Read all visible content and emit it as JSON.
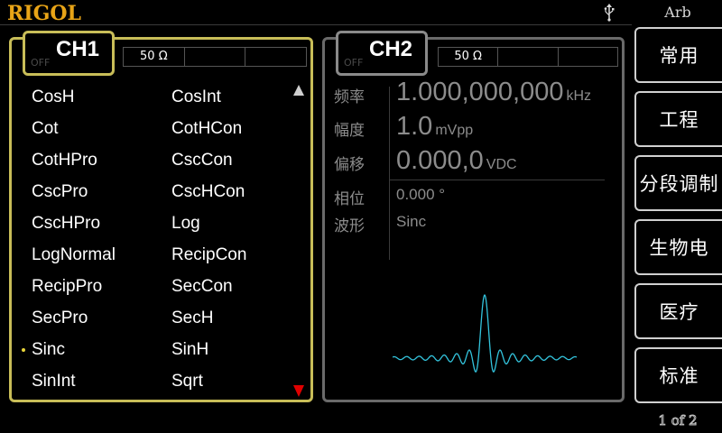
{
  "brand": "RIGOL",
  "mode_title": "Arb",
  "icons": {
    "usb": "usb-icon",
    "scroll_up": "scroll-up-arrow-icon",
    "scroll_down": "scroll-down-arrow-icon",
    "selected": "selected-dot-icon"
  },
  "colors": {
    "brand": "#e8a417",
    "ch1_accent": "#c8bd58",
    "ch2_border": "#6a6a6a",
    "waveform": "#33c4dd",
    "scroll_down": "#e00000"
  },
  "ch1": {
    "label": "CH1",
    "state": "OFF",
    "impedance": "50 Ω",
    "waveforms": [
      "CosH",
      "CosInt",
      "Cot",
      "CotHCon",
      "CotHPro",
      "CscCon",
      "CscPro",
      "CscHCon",
      "CscHPro",
      "Log",
      "LogNormal",
      "RecipCon",
      "RecipPro",
      "SecCon",
      "SecPro",
      "SecH",
      "Sinc",
      "SinH",
      "SinInt",
      "Sqrt"
    ],
    "selected_waveform": "Sinc"
  },
  "ch2": {
    "label": "CH2",
    "state": "OFF",
    "impedance": "50 Ω",
    "params": {
      "freq_label": "频率",
      "freq_value": "1.000,000,000",
      "freq_unit": "kHz",
      "amp_label": "幅度",
      "amp_value": "1.0",
      "amp_unit": "mVpp",
      "offset_label": "偏移",
      "offset_value": "0.000,0",
      "offset_unit": "VDC",
      "phase_label": "相位",
      "phase_value": "0.000 °",
      "wave_label": "波形",
      "wave_value": "Sinc"
    }
  },
  "menu": {
    "items": [
      "常用",
      "工程",
      "分段调制",
      "生物电",
      "医疗",
      "标准"
    ],
    "page": "1 of 2"
  }
}
